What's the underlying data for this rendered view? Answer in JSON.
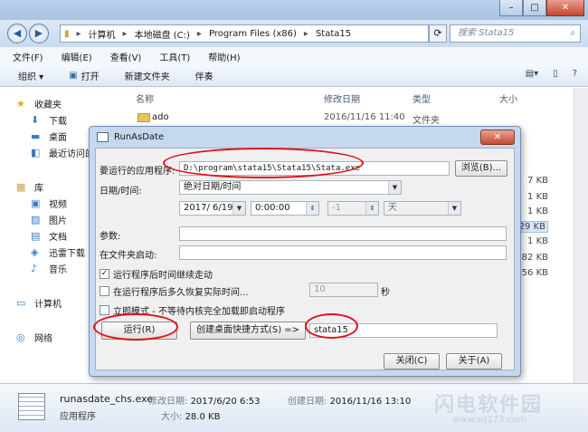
{
  "explorer": {
    "window_buttons": [
      "–",
      "□",
      "✕"
    ],
    "breadcrumb": [
      "计算机",
      "本地磁盘 (C:)",
      "Program Files (x86)",
      "Stata15"
    ],
    "search_placeholder": "搜索 Stata15",
    "menu": [
      "文件(F)",
      "编辑(E)",
      "查看(V)",
      "工具(T)",
      "帮助(H)"
    ],
    "toolbar": {
      "organize": "组织 ▾",
      "open": "打开",
      "new_folder": "新建文件夹",
      "share": "伴奏"
    },
    "nav": {
      "favorites": "收藏夹",
      "favorites_items": [
        "下载",
        "桌面",
        "最近访问的"
      ],
      "libraries": "库",
      "library_items": [
        "视频",
        "图片",
        "文档",
        "迅雷下载",
        "音乐"
      ],
      "computer": "计算机",
      "network": "网络"
    },
    "columns": {
      "name": "名称",
      "modified": "修改日期",
      "type": "类型",
      "size": "大小"
    },
    "file": {
      "name": "ado",
      "modified": "2016/11/16 11:40",
      "type": "文件夹"
    },
    "sizes": [
      "7 KB",
      "1 KB",
      "1 KB",
      "29 KB",
      "1 KB",
      "282 KB",
      "56 KB"
    ],
    "details": {
      "name": "runasdate_chs.exe",
      "type": "应用程序",
      "modified_label": "修改日期:",
      "modified": "2017/6/20 6:53",
      "created_label": "创建日期:",
      "created": "2016/11/16 13:10",
      "size_label": "大小:",
      "size": "28.0 KB",
      "watermark": "闪电软件园",
      "watermark_url": "www.sd173.com"
    }
  },
  "dialog": {
    "title": "RunAsDate",
    "close": "✕",
    "app_path_label": "要运行的应用程序:",
    "app_path": "D:\\program\\stata15\\Stata15\\Stata.exe",
    "browse": "浏览(B)...",
    "datetime_label": "日期/时间:",
    "mode_value": "绝对日期/时间",
    "date_value": "2017/ 6/19",
    "time_value": "0:00:00",
    "offset_value": "-1",
    "unit_value": "天",
    "params_label": "参数:",
    "startdir_label": "在文件夹启动:",
    "opt1": "运行程序后时间继续走动",
    "opt2": "在运行程序后多久恢复实际时间...",
    "opt2_value": "10",
    "opt2_unit": "秒",
    "opt3": "立即模式 - 不等待内核完全加载即启动程序",
    "run_button": "运行(R)",
    "shortcut_button": "创建桌面快捷方式(S) =>",
    "shortcut_name": "stata15",
    "close_button": "关闭(C)",
    "about_button": "关于(A)"
  },
  "colors": {
    "annotation": "#e0101a",
    "title_bar": "#b9d1ea",
    "dialog_frame": "#c6d8ee"
  }
}
